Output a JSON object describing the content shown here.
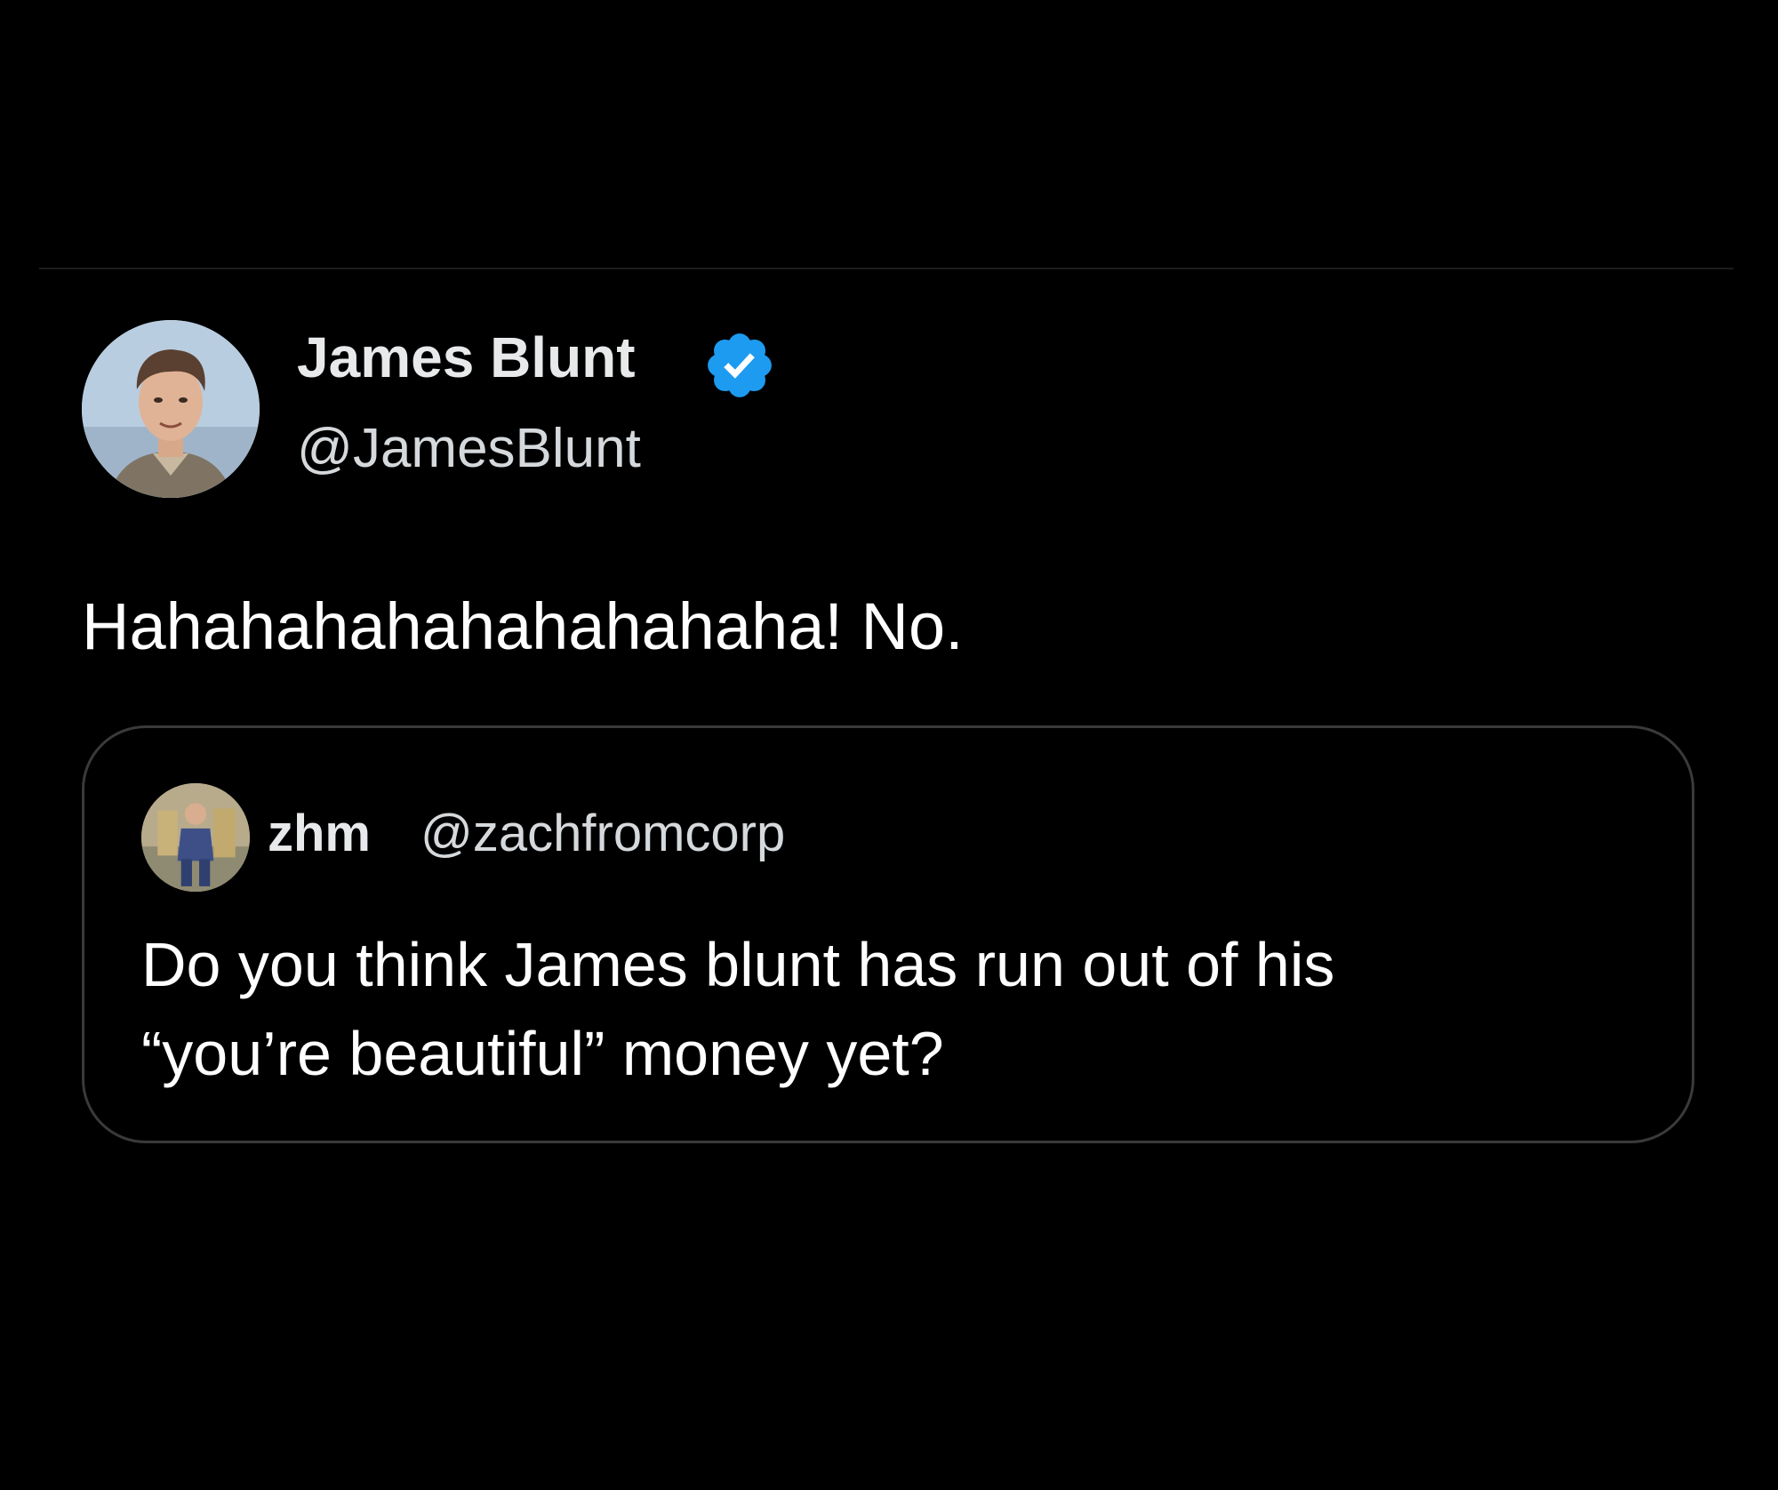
{
  "tweet": {
    "author": {
      "display_name": "James Blunt",
      "handle": "@JamesBlunt",
      "verified": true,
      "avatar_icon": "profile-photo-icon"
    },
    "text": "Hahahahahahahahahaha! No.",
    "quoted": {
      "author": {
        "display_name": "zhm",
        "handle": "@zachfromcorp",
        "avatar_icon": "profile-photo-icon"
      },
      "text_lines": [
        "Do you think James blunt has run out of his",
        "“you’re beautiful” money yet?"
      ]
    }
  },
  "colors": {
    "background": "#000000",
    "text_primary": "#e7e9ea",
    "text_secondary": "#d6d9dc",
    "verified_badge": "#1d9bf0",
    "card_border": "#3a3a3a"
  }
}
